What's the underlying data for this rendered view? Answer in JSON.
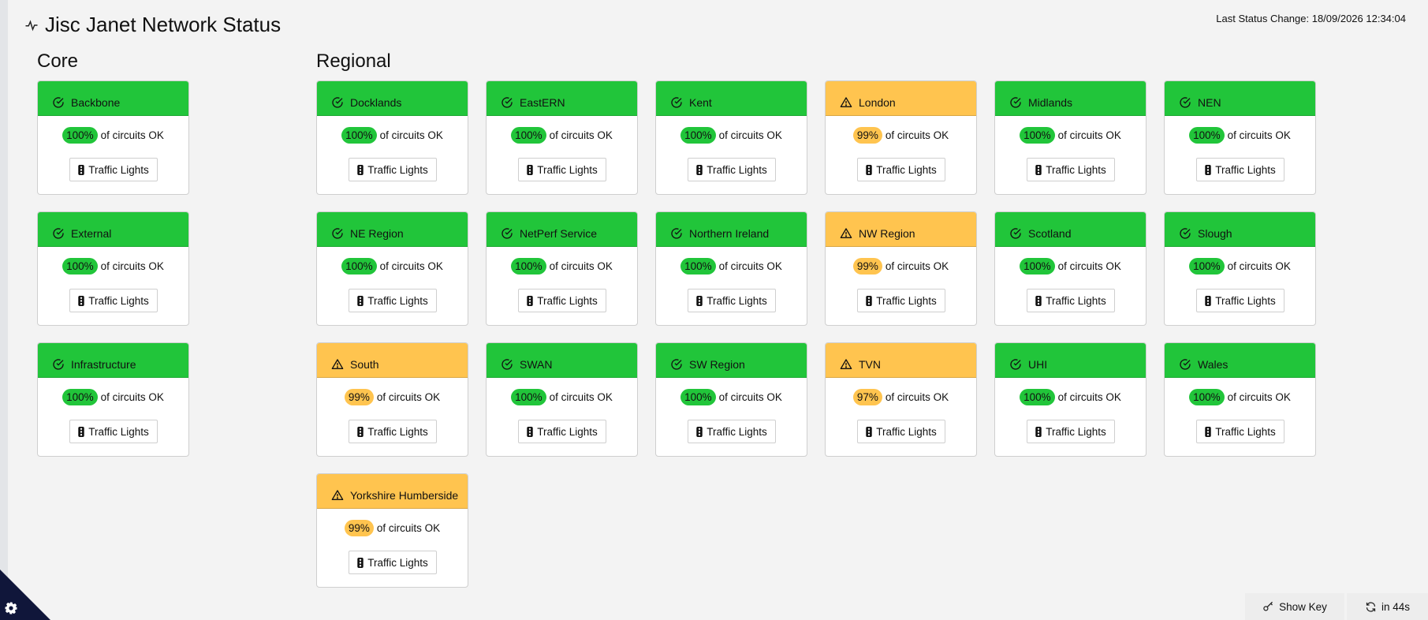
{
  "header": {
    "title": "Jisc Janet Network Status",
    "last_change": "Last Status Change: 18/09/2026 12:34:04"
  },
  "sections": {
    "core": "Core",
    "regional": "Regional"
  },
  "labels": {
    "circuits_ok": "of circuits OK",
    "traffic_lights": "Traffic Lights"
  },
  "colors": {
    "ok": "#21c53a",
    "warn": "#ffc44f"
  },
  "core": [
    {
      "name": "Backbone",
      "status": "ok",
      "pct": "100%"
    },
    {
      "name": "External",
      "status": "ok",
      "pct": "100%"
    },
    {
      "name": "Infrastructure",
      "status": "ok",
      "pct": "100%"
    }
  ],
  "regional": [
    {
      "name": "Docklands",
      "status": "ok",
      "pct": "100%"
    },
    {
      "name": "EastERN",
      "status": "ok",
      "pct": "100%"
    },
    {
      "name": "Kent",
      "status": "ok",
      "pct": "100%"
    },
    {
      "name": "London",
      "status": "warn",
      "pct": "99%"
    },
    {
      "name": "Midlands",
      "status": "ok",
      "pct": "100%"
    },
    {
      "name": "NEN",
      "status": "ok",
      "pct": "100%"
    },
    {
      "name": "NE Region",
      "status": "ok",
      "pct": "100%"
    },
    {
      "name": "NetPerf Service",
      "status": "ok",
      "pct": "100%"
    },
    {
      "name": "Northern Ireland",
      "status": "ok",
      "pct": "100%"
    },
    {
      "name": "NW Region",
      "status": "warn",
      "pct": "99%"
    },
    {
      "name": "Scotland",
      "status": "ok",
      "pct": "100%"
    },
    {
      "name": "Slough",
      "status": "ok",
      "pct": "100%"
    },
    {
      "name": "South",
      "status": "warn",
      "pct": "99%"
    },
    {
      "name": "SWAN",
      "status": "ok",
      "pct": "100%"
    },
    {
      "name": "SW Region",
      "status": "ok",
      "pct": "100%"
    },
    {
      "name": "TVN",
      "status": "warn",
      "pct": "97%"
    },
    {
      "name": "UHI",
      "status": "ok",
      "pct": "100%"
    },
    {
      "name": "Wales",
      "status": "ok",
      "pct": "100%"
    },
    {
      "name": "Yorkshire Humberside",
      "status": "warn",
      "pct": "99%"
    }
  ],
  "footer": {
    "show_key": "Show Key",
    "refresh": "in 44s"
  }
}
